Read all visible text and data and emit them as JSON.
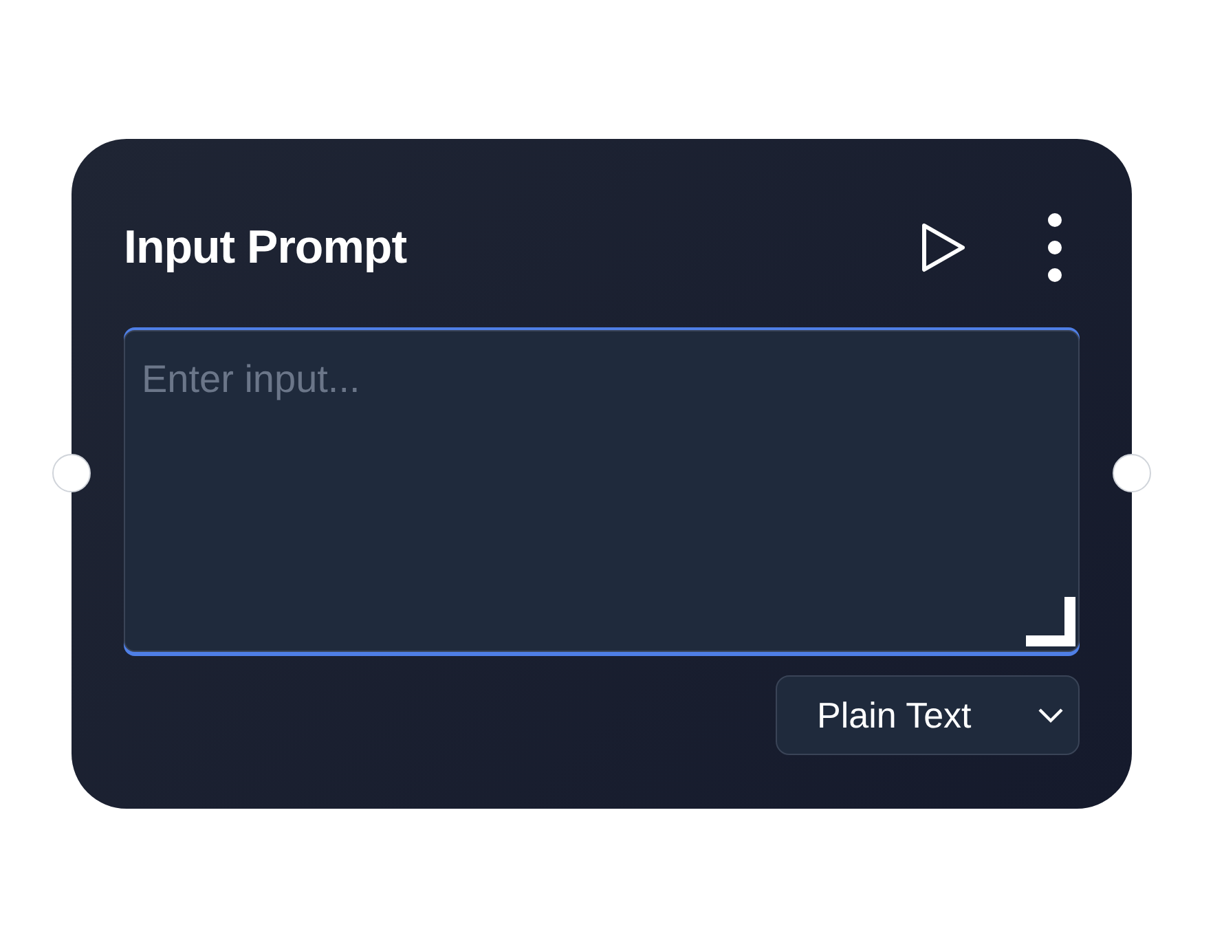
{
  "node": {
    "title": "Input Prompt",
    "input": {
      "placeholder": "Enter input..."
    },
    "format_select": {
      "value": "Plain Text"
    }
  }
}
